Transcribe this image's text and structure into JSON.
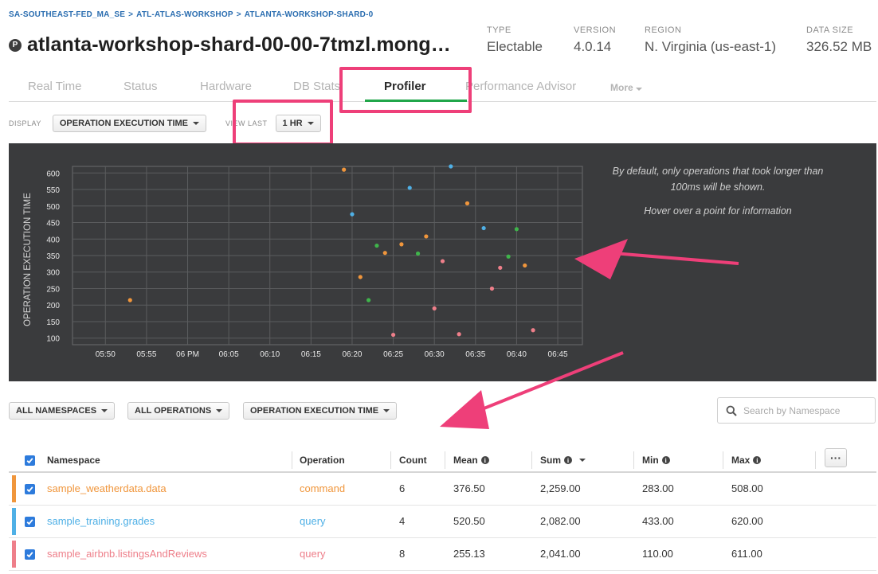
{
  "breadcrumb": [
    "SA-SOUTHEAST-FED_MA_SE",
    "ATL-ATLAS-WORKSHOP",
    "ATLANTA-WORKSHOP-SHARD-0"
  ],
  "cluster": {
    "badge": "P",
    "title": "atlanta-workshop-shard-00-00-7tmzl.mong…"
  },
  "meta": [
    {
      "label": "TYPE",
      "value": "Electable"
    },
    {
      "label": "VERSION",
      "value": "4.0.14"
    },
    {
      "label": "REGION",
      "value": "N. Virginia (us-east-1)"
    },
    {
      "label": "DATA SIZE",
      "value": "326.52 MB"
    }
  ],
  "tabs": {
    "real_time": "Real Time",
    "status": "Status",
    "hardware": "Hardware",
    "db_stats": "DB Stats",
    "profiler": "Profiler",
    "performance_advisor": "Performance Advisor",
    "more": "More"
  },
  "controls": {
    "display_label": "DISPLAY",
    "display_value": "OPERATION EXECUTION TIME",
    "view_last_label": "VIEW LAST",
    "view_last_value": "1 HR"
  },
  "chart_note": {
    "line1": "By default, only operations that took longer than 100ms will be shown.",
    "line2": "Hover over a point for information"
  },
  "colors": {
    "orange": "#f0963c",
    "blue": "#4fb0e6",
    "green": "#3fb44b",
    "pink": "#ee7f8a",
    "highlight": "#ee3f79",
    "tab_active": "#21a64a"
  },
  "chart_data": {
    "type": "scatter",
    "title": "",
    "xlabel": "",
    "ylabel": "OPERATION EXECUTION TIME",
    "x_ticks": [
      "05:50",
      "05:55",
      "06 PM",
      "06:05",
      "06:10",
      "06:15",
      "06:20",
      "06:25",
      "06:30",
      "06:35",
      "06:40",
      "06:45"
    ],
    "xlim": [
      "05:46",
      "06:48"
    ],
    "ylim": [
      80,
      620
    ],
    "y_ticks": [
      100,
      150,
      200,
      250,
      300,
      350,
      400,
      450,
      500,
      550,
      600
    ],
    "grid": true,
    "series": [
      {
        "color_key": "orange",
        "points": [
          {
            "x": "05:53",
            "y": 215
          },
          {
            "x": "06:19",
            "y": 610
          },
          {
            "x": "06:21",
            "y": 285
          },
          {
            "x": "06:24",
            "y": 358
          },
          {
            "x": "06:26",
            "y": 384
          },
          {
            "x": "06:29",
            "y": 408
          },
          {
            "x": "06:34",
            "y": 508
          },
          {
            "x": "06:41",
            "y": 320
          }
        ]
      },
      {
        "color_key": "blue",
        "points": [
          {
            "x": "06:20",
            "y": 475
          },
          {
            "x": "06:27",
            "y": 555
          },
          {
            "x": "06:32",
            "y": 620
          },
          {
            "x": "06:36",
            "y": 433
          }
        ]
      },
      {
        "color_key": "green",
        "points": [
          {
            "x": "06:22",
            "y": 215
          },
          {
            "x": "06:23",
            "y": 380
          },
          {
            "x": "06:28",
            "y": 356
          },
          {
            "x": "06:39",
            "y": 347
          },
          {
            "x": "06:40",
            "y": 430
          }
        ]
      },
      {
        "color_key": "pink",
        "points": [
          {
            "x": "06:25",
            "y": 110
          },
          {
            "x": "06:30",
            "y": 190
          },
          {
            "x": "06:31",
            "y": 333
          },
          {
            "x": "06:33",
            "y": 112
          },
          {
            "x": "06:37",
            "y": 250
          },
          {
            "x": "06:38",
            "y": 313
          },
          {
            "x": "06:42",
            "y": 124
          }
        ]
      }
    ]
  },
  "filters": {
    "namespaces": "ALL NAMESPACES",
    "operations": "ALL OPERATIONS",
    "metric": "OPERATION EXECUTION TIME",
    "search_placeholder": "Search by Namespace"
  },
  "table": {
    "headers": {
      "namespace": "Namespace",
      "operation": "Operation",
      "count": "Count",
      "mean": "Mean",
      "sum": "Sum",
      "min": "Min",
      "max": "Max"
    },
    "rows": [
      {
        "color_key": "orange",
        "namespace": "sample_weatherdata.data",
        "operation": "command",
        "count": "6",
        "mean": "376.50",
        "sum": "2,259.00",
        "min": "283.00",
        "max": "508.00"
      },
      {
        "color_key": "blue",
        "namespace": "sample_training.grades",
        "operation": "query",
        "count": "4",
        "mean": "520.50",
        "sum": "2,082.00",
        "min": "433.00",
        "max": "620.00"
      },
      {
        "color_key": "pink",
        "namespace": "sample_airbnb.listingsAndReviews",
        "operation": "query",
        "count": "8",
        "mean": "255.13",
        "sum": "2,041.00",
        "min": "110.00",
        "max": "611.00"
      }
    ]
  }
}
